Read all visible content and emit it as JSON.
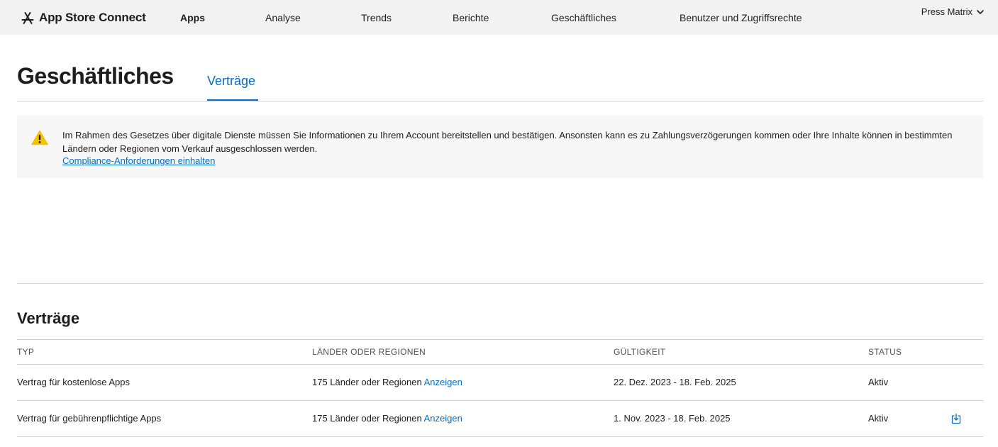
{
  "nav": {
    "brand": "App Store Connect",
    "items": [
      {
        "label": "Apps",
        "active": true
      },
      {
        "label": "Analyse",
        "active": false
      },
      {
        "label": "Trends",
        "active": false
      },
      {
        "label": "Berichte",
        "active": false
      },
      {
        "label": "Geschäftliches",
        "active": false
      },
      {
        "label": "Benutzer und Zugriffsrechte",
        "active": false
      }
    ],
    "account": "Press Matrix"
  },
  "page": {
    "title": "Geschäftliches",
    "tab": "Verträge"
  },
  "notice": {
    "text": "Im Rahmen des Gesetzes über digitale Dienste müssen Sie Informationen zu Ihrem Account bereitstellen und bestätigen. Ansonsten kann es zu Zahlungsverzögerungen kommen oder Ihre Inhalte können in bestimmten Ländern oder Regionen vom Verkauf ausgeschlossen werden.",
    "link": "Compliance-Anforderungen einhalten"
  },
  "contracts": {
    "title": "Verträge",
    "columns": [
      "TYP",
      "LÄNDER ODER REGIONEN",
      "GÜLTIGKEIT",
      "STATUS"
    ],
    "rows": [
      {
        "type": "Vertrag für kostenlose Apps",
        "regions": "175 Länder oder Regionen",
        "regions_link": "Anzeigen",
        "validity": "22. Dez. 2023 - 18. Feb. 2025",
        "status": "Aktiv"
      },
      {
        "type": "Vertrag für gebührenpflichtige Apps",
        "regions": "175 Länder oder Regionen",
        "regions_link": "Anzeigen",
        "validity": "1. Nov. 2023 - 18. Feb. 2025",
        "status": "Aktiv"
      }
    ]
  },
  "colors": {
    "accent": "#0070c9",
    "warning": "#f5c400",
    "nav_bg": "#f2f2f2"
  },
  "icons": {
    "brand": "app-store-icon",
    "warning": "warning-triangle-icon",
    "account_chevron": "chevron-down-icon",
    "download": "download-icon"
  }
}
